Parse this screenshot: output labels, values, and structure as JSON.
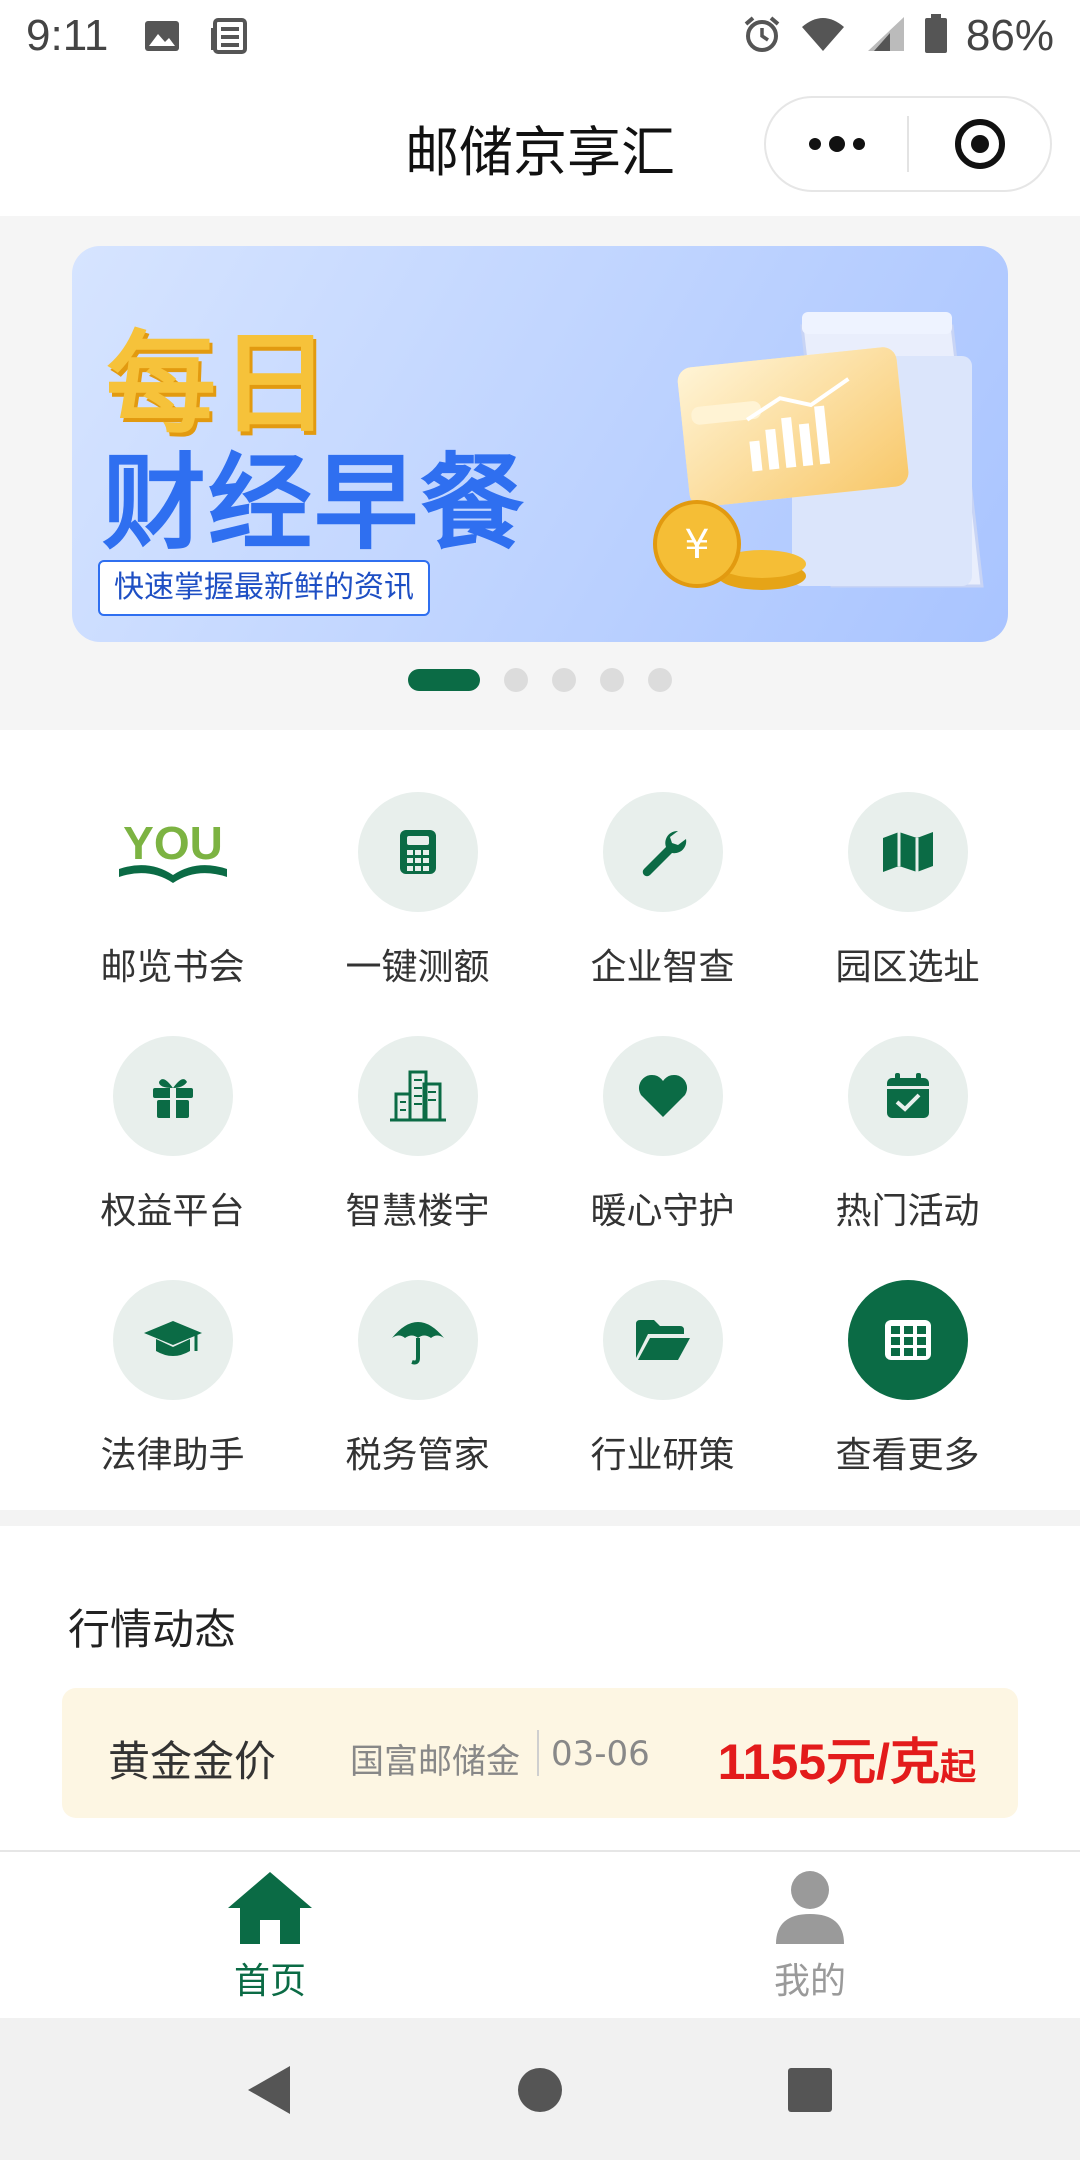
{
  "status_bar": {
    "time": "9:11",
    "battery": "86%",
    "left_icons": [
      "image-icon",
      "news-icon"
    ],
    "right_icons": [
      "alarm-icon",
      "wifi-icon",
      "signal-icon",
      "battery-icon"
    ]
  },
  "header": {
    "title": "邮储京享汇",
    "menu_icon": "more-dots-icon",
    "close_icon": "target-icon"
  },
  "banner": {
    "title_line1": "每日",
    "title_line2": "财经早餐",
    "subtitle": "快速掌握最新鲜的资讯",
    "slides_total": 5,
    "active_index": 0
  },
  "grid": {
    "items": [
      {
        "label": "邮览书会",
        "icon": "you-logo-icon"
      },
      {
        "label": "一键测额",
        "icon": "calculator-icon"
      },
      {
        "label": "企业智查",
        "icon": "wrench-icon"
      },
      {
        "label": "园区选址",
        "icon": "map-icon"
      },
      {
        "label": "权益平台",
        "icon": "gift-icon"
      },
      {
        "label": "智慧楼宇",
        "icon": "building-icon"
      },
      {
        "label": "暖心守护",
        "icon": "heart-icon"
      },
      {
        "label": "热门活动",
        "icon": "calendar-check-icon"
      },
      {
        "label": "法律助手",
        "icon": "graduation-cap-icon"
      },
      {
        "label": "税务管家",
        "icon": "umbrella-icon"
      },
      {
        "label": "行业研策",
        "icon": "folder-open-icon"
      },
      {
        "label": "查看更多",
        "icon": "grid-more-icon"
      }
    ]
  },
  "market": {
    "title": "行情动态",
    "gold": {
      "name": "黄金金价",
      "source": "国富邮储金",
      "date": "03-06",
      "price": "1155元/克",
      "price_suffix": "起"
    }
  },
  "tabs": [
    {
      "label": "首页",
      "icon": "home-icon",
      "active": true
    },
    {
      "label": "我的",
      "icon": "user-icon",
      "active": false
    }
  ],
  "nav": {
    "buttons": [
      "back-icon",
      "home-circle-icon",
      "recents-icon"
    ]
  },
  "colors": {
    "brand_green": "#0b6b45",
    "icon_bg": "#e8efec",
    "price_red": "#e31b1b",
    "gold_card_bg": "#fdf6e3"
  }
}
